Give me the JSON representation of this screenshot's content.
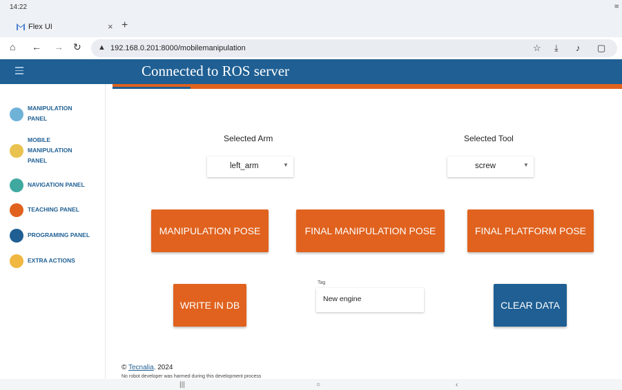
{
  "status_bar": {
    "time": "14:22"
  },
  "browser": {
    "tab_title": "Flex UI",
    "tab_close": "×",
    "new_tab": "+",
    "url": "192.168.0.201:8000/mobilemanipulation",
    "security_icon": "warning-triangle-icon"
  },
  "header": {
    "title": "Connected to ROS server"
  },
  "sidebar": {
    "items": [
      {
        "label": "MANIPULATION\nPANEL",
        "icon": "robot-arm-icon",
        "color": "#6fb2d8"
      },
      {
        "label": "MOBILE\nMANIPULATION\nPANEL",
        "icon": "mobile-robot-icon",
        "color": "#e9c24f"
      },
      {
        "label": "NAVIGATION PANEL",
        "icon": "navigation-icon",
        "color": "#3fa9a0"
      },
      {
        "label": "TEACHING PANEL",
        "icon": "teaching-icon",
        "color": "#e0621e"
      },
      {
        "label": "PROGRAMING PANEL",
        "icon": "programming-icon",
        "color": "#1f5f93"
      },
      {
        "label": "EXTRA ACTIONS",
        "icon": "extra-actions-icon",
        "color": "#f0b840"
      }
    ]
  },
  "main": {
    "arm_label": "Selected Arm",
    "arm_value": "left_arm",
    "tool_label": "Selected Tool",
    "tool_value": "screw",
    "buttons": {
      "manipulation_pose": "MANIPULATION POSE",
      "final_manipulation_pose": "FINAL MANIPULATION POSE",
      "final_platform_pose": "FINAL PLATFORM POSE",
      "write_in_db": "WRITE IN DB",
      "clear_data": "CLEAR DATA"
    },
    "tag_label": "Tag",
    "tag_value": "New engine"
  },
  "footer": {
    "copyright_symbol": "©",
    "link": "Tecnalia",
    "year": ". 2024",
    "note": "No robot developer was harmed during this development process"
  },
  "colors": {
    "accent_blue": "#1f5f93",
    "accent_orange": "#e0621e"
  }
}
